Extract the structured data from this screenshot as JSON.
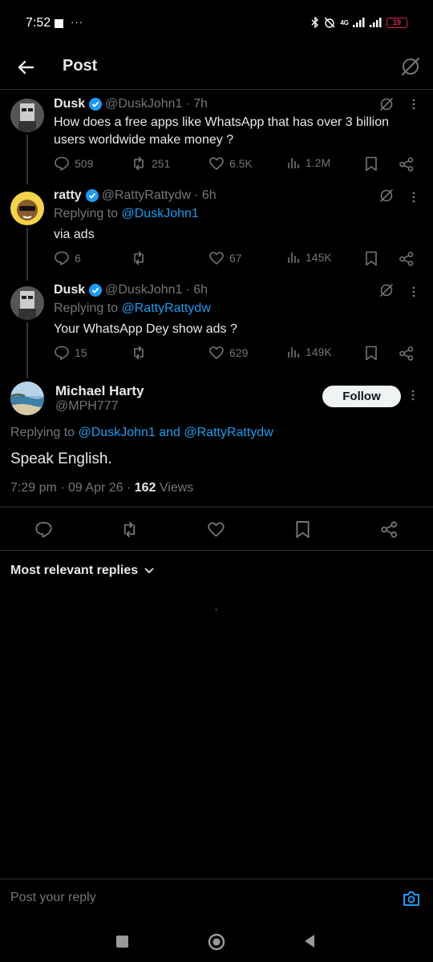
{
  "status_bar": {
    "time": "7:52",
    "dots": "···",
    "network": "4G",
    "battery": "19"
  },
  "header": {
    "title": "Post"
  },
  "thread": [
    {
      "name": "Dusk",
      "handle": "@DuskJohn1",
      "time": "· 7h",
      "replying_prefix": "",
      "replying_to": "",
      "text": "How does a  free apps like WhatsApp that has over 3 billion users worldwide make money ?",
      "replies": "509",
      "reposts": "251",
      "likes": "6.5K",
      "views": "1.2M"
    },
    {
      "name": "ratty",
      "handle": "@RattyRattydw",
      "time": "· 6h",
      "replying_prefix": "Replying to ",
      "replying_to": "@DuskJohn1",
      "text": "via ads",
      "replies": "6",
      "reposts": "",
      "likes": "67",
      "views": "145K"
    },
    {
      "name": "Dusk",
      "handle": "@DuskJohn1",
      "time": "· 6h",
      "replying_prefix": "Replying to ",
      "replying_to": "@RattyRattydw",
      "text": "Your WhatsApp Dey show ads ?",
      "replies": "15",
      "reposts": "",
      "likes": "629",
      "views": "149K"
    }
  ],
  "focus": {
    "name": "Michael Harty",
    "handle": "@MPH777",
    "follow_label": "Follow",
    "replying_prefix": "Replying to ",
    "replying_to": "@DuskJohn1 and @RattyRattydw",
    "text": "Speak English.",
    "meta_prefix": "7:29 pm · 09 Apr 26 · ",
    "views_count": "162",
    "views_label": " Views"
  },
  "replies_sort": {
    "label": "Most relevant replies"
  },
  "reply_bar": {
    "placeholder": "Post your reply"
  },
  "colors": {
    "accent": "#1d9bf0",
    "muted": "#71767b",
    "background": "#000000",
    "divider": "#2f3336"
  }
}
